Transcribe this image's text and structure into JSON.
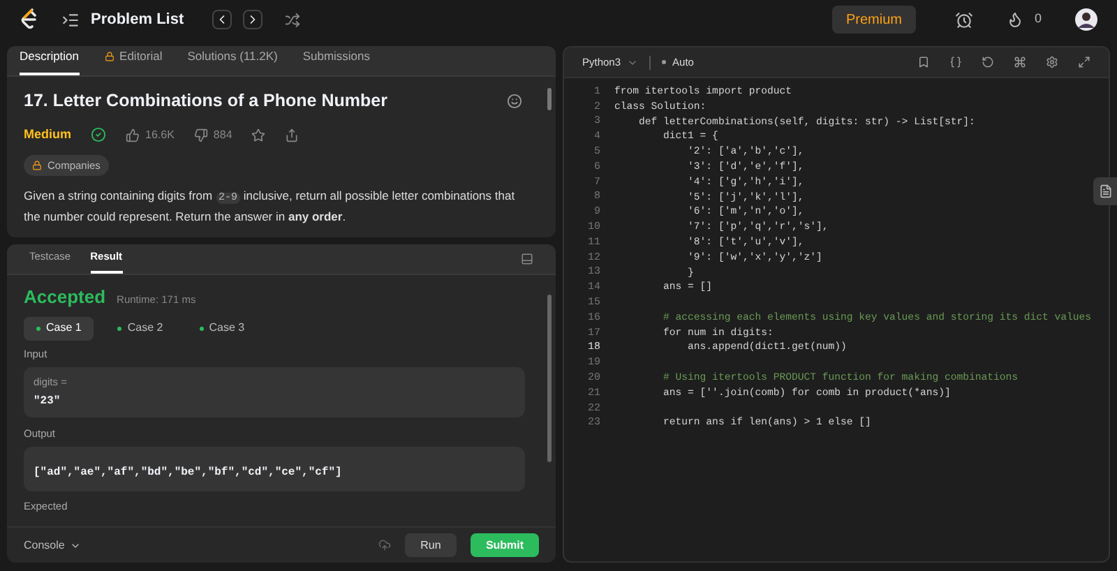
{
  "nav": {
    "title": "Problem List",
    "premium": "Premium",
    "streak": "0"
  },
  "description_tabs": [
    {
      "label": "Description",
      "selected": true,
      "locked": false
    },
    {
      "label": "Editorial",
      "selected": false,
      "locked": true
    },
    {
      "label": "Solutions (11.2K)",
      "selected": false,
      "locked": false
    },
    {
      "label": "Submissions",
      "selected": false,
      "locked": false
    }
  ],
  "problem": {
    "title": "17. Letter Combinations of a Phone Number",
    "difficulty": "Medium",
    "solved": true,
    "likes": "16.6K",
    "dislikes": "884",
    "companies": "Companies",
    "text_before": "Given a string containing digits from",
    "code": "2-9",
    "text_after": "inclusive, return all possible letter combinations that the number could represent. Return the answer in **any order**."
  },
  "result_tabs": [
    {
      "label": "Testcase",
      "selected": false
    },
    {
      "label": "Result",
      "selected": true
    }
  ],
  "result": {
    "status": "Accepted",
    "runtime": "Runtime: 171 ms",
    "cases": [
      {
        "label": "Case 1",
        "selected": true
      },
      {
        "label": "Case 2",
        "selected": false
      },
      {
        "label": "Case 3",
        "selected": false
      }
    ],
    "input_label": "Input",
    "input_name": "digits =",
    "input_value": "\"23\"",
    "output_label": "Output",
    "output_value": "[\"ad\",\"ae\",\"af\",\"bd\",\"be\",\"bf\",\"cd\",\"ce\",\"cf\"]",
    "expected_label": "Expected"
  },
  "footer": {
    "console": "Console",
    "run": "Run",
    "submit": "Submit"
  },
  "editor": {
    "language": "Python3",
    "mode": "Auto",
    "lines": [
      {
        "n": "1",
        "text": "from itertools import product",
        "kind": "code",
        "active": false
      },
      {
        "n": "2",
        "text": "class Solution:",
        "kind": "code",
        "active": false
      },
      {
        "n": "3",
        "text": "    def letterCombinations(self, digits: str) -> List[str]:",
        "kind": "code",
        "active": false
      },
      {
        "n": "4",
        "text": "        dict1 = {",
        "kind": "code",
        "active": false
      },
      {
        "n": "5",
        "text": "            '2': ['a','b','c'],",
        "kind": "code",
        "active": false
      },
      {
        "n": "6",
        "text": "            '3': ['d','e','f'],",
        "kind": "code",
        "active": false
      },
      {
        "n": "7",
        "text": "            '4': ['g','h','i'],",
        "kind": "code",
        "active": false
      },
      {
        "n": "8",
        "text": "            '5': ['j','k','l'],",
        "kind": "code",
        "active": false
      },
      {
        "n": "9",
        "text": "            '6': ['m','n','o'],",
        "kind": "code",
        "active": false
      },
      {
        "n": "10",
        "text": "            '7': ['p','q','r','s'],",
        "kind": "code",
        "active": false
      },
      {
        "n": "11",
        "text": "            '8': ['t','u','v'],",
        "kind": "code",
        "active": false
      },
      {
        "n": "12",
        "text": "            '9': ['w','x','y','z']",
        "kind": "code",
        "active": false
      },
      {
        "n": "13",
        "text": "            }",
        "kind": "code",
        "active": false
      },
      {
        "n": "14",
        "text": "        ans = []",
        "kind": "code",
        "active": false
      },
      {
        "n": "15",
        "kind": "blank",
        "active": false
      },
      {
        "n": "16",
        "text": "        # accessing each elements using key values and storing its dict values",
        "kind": "comment",
        "active": false
      },
      {
        "n": "17",
        "text": "        for num in digits:",
        "kind": "code",
        "active": false
      },
      {
        "n": "18",
        "text": "            ans.append(dict1.get(num))",
        "kind": "code",
        "active": true
      },
      {
        "n": "19",
        "kind": "blank",
        "active": false
      },
      {
        "n": "20",
        "text": "        # Using itertools PRODUCT function for making combinations",
        "kind": "comment",
        "active": false
      },
      {
        "n": "21",
        "text": "        ans = [''.join(comb) for comb in product(*ans)]",
        "kind": "code",
        "active": false
      },
      {
        "n": "22",
        "kind": "blank",
        "active": false
      },
      {
        "n": "23",
        "text": "        return ans if len(ans) > 1 else []",
        "kind": "code",
        "active": false
      }
    ]
  }
}
